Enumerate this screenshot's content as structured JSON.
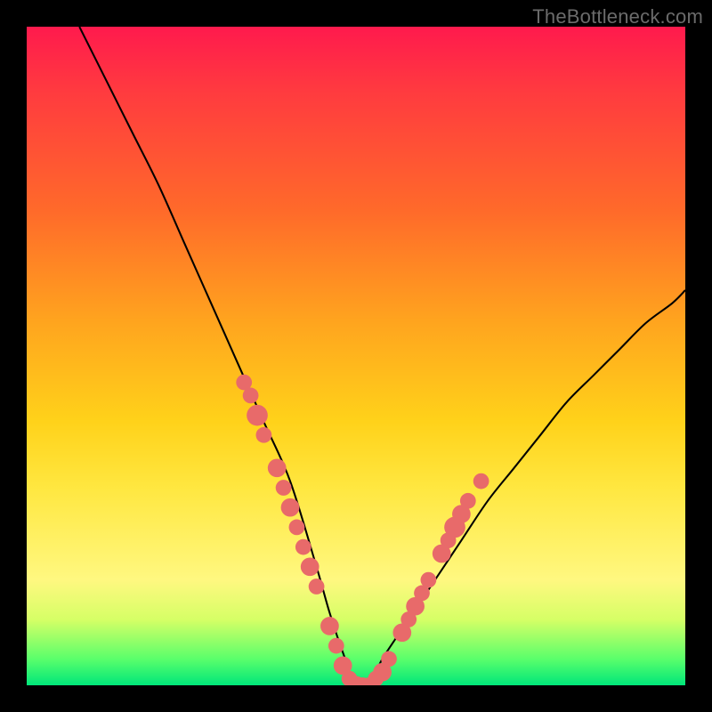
{
  "watermark": "TheBottleneck.com",
  "chart_data": {
    "type": "line",
    "title": "",
    "xlabel": "",
    "ylabel": "",
    "xlim": [
      0,
      100
    ],
    "ylim": [
      0,
      100
    ],
    "series": [
      {
        "name": "bottleneck-curve",
        "x": [
          8,
          12,
          16,
          20,
          24,
          28,
          32,
          36,
          40,
          44,
          46,
          48,
          50,
          52,
          54,
          58,
          62,
          66,
          70,
          74,
          78,
          82,
          86,
          90,
          94,
          98,
          100
        ],
        "y": [
          100,
          92,
          84,
          76,
          67,
          58,
          49,
          40,
          31,
          18,
          11,
          5,
          0,
          0,
          4,
          10,
          16,
          22,
          28,
          33,
          38,
          43,
          47,
          51,
          55,
          58,
          60
        ]
      }
    ],
    "markers": [
      {
        "x": 33,
        "y": 46,
        "r": 1.2
      },
      {
        "x": 34,
        "y": 44,
        "r": 1.2
      },
      {
        "x": 35,
        "y": 41,
        "r": 1.6
      },
      {
        "x": 36,
        "y": 38,
        "r": 1.2
      },
      {
        "x": 38,
        "y": 33,
        "r": 1.4
      },
      {
        "x": 39,
        "y": 30,
        "r": 1.2
      },
      {
        "x": 40,
        "y": 27,
        "r": 1.4
      },
      {
        "x": 41,
        "y": 24,
        "r": 1.2
      },
      {
        "x": 42,
        "y": 21,
        "r": 1.2
      },
      {
        "x": 43,
        "y": 18,
        "r": 1.4
      },
      {
        "x": 44,
        "y": 15,
        "r": 1.2
      },
      {
        "x": 46,
        "y": 9,
        "r": 1.4
      },
      {
        "x": 47,
        "y": 6,
        "r": 1.2
      },
      {
        "x": 48,
        "y": 3,
        "r": 1.4
      },
      {
        "x": 49,
        "y": 1,
        "r": 1.2
      },
      {
        "x": 50,
        "y": 0,
        "r": 1.4
      },
      {
        "x": 51,
        "y": 0,
        "r": 1.2
      },
      {
        "x": 52,
        "y": 0,
        "r": 1.2
      },
      {
        "x": 53,
        "y": 1,
        "r": 1.2
      },
      {
        "x": 54,
        "y": 2,
        "r": 1.4
      },
      {
        "x": 55,
        "y": 4,
        "r": 1.2
      },
      {
        "x": 57,
        "y": 8,
        "r": 1.4
      },
      {
        "x": 58,
        "y": 10,
        "r": 1.2
      },
      {
        "x": 59,
        "y": 12,
        "r": 1.4
      },
      {
        "x": 60,
        "y": 14,
        "r": 1.2
      },
      {
        "x": 61,
        "y": 16,
        "r": 1.2
      },
      {
        "x": 63,
        "y": 20,
        "r": 1.4
      },
      {
        "x": 64,
        "y": 22,
        "r": 1.2
      },
      {
        "x": 65,
        "y": 24,
        "r": 1.6
      },
      {
        "x": 66,
        "y": 26,
        "r": 1.4
      },
      {
        "x": 67,
        "y": 28,
        "r": 1.2
      },
      {
        "x": 69,
        "y": 31,
        "r": 1.2
      }
    ],
    "marker_color": "#e86a6a",
    "curve_color": "#000000"
  }
}
